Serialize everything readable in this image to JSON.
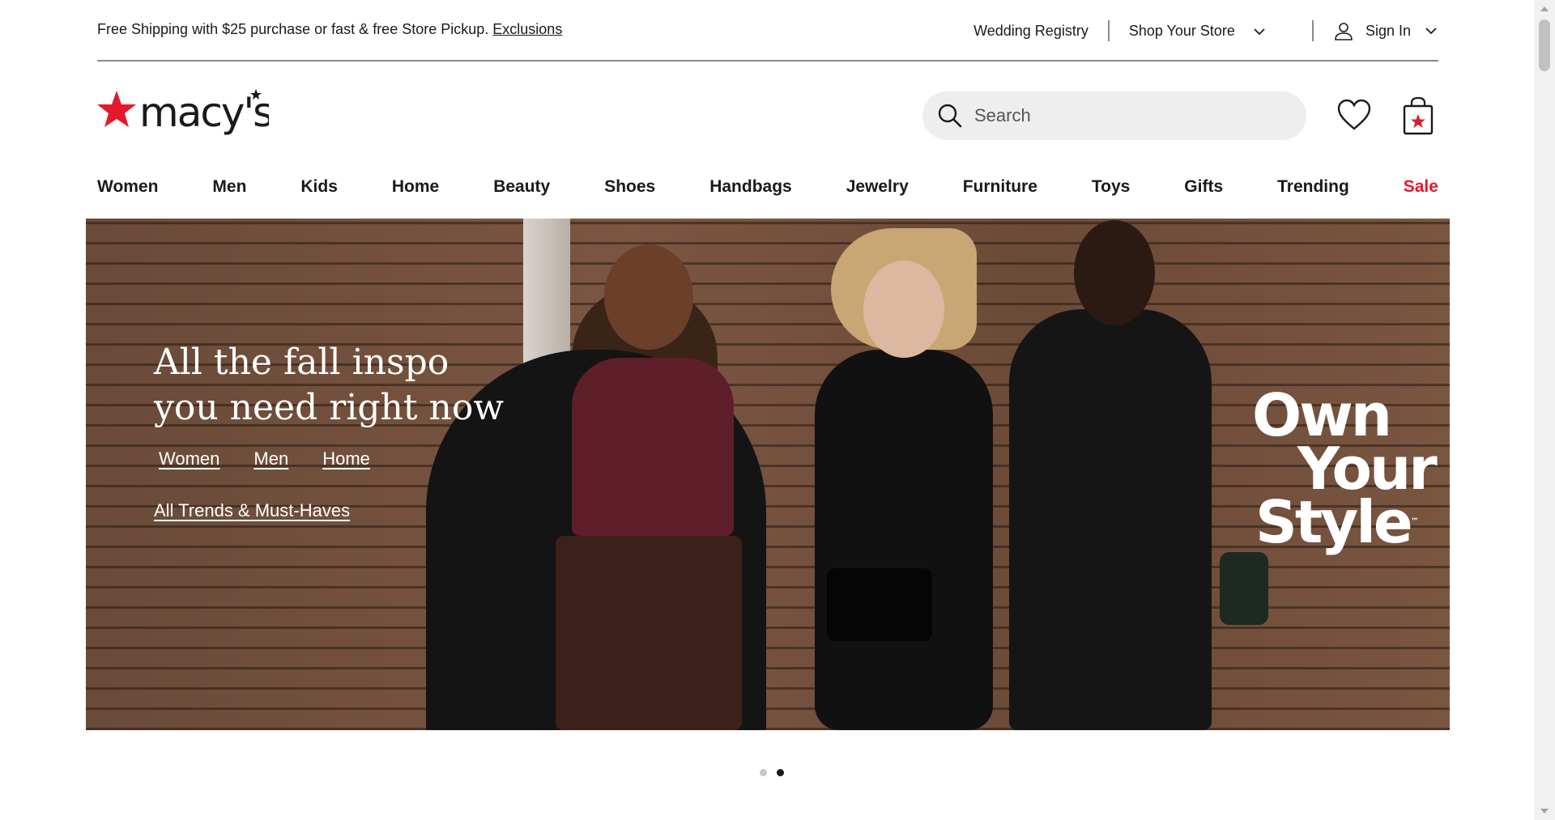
{
  "utility": {
    "promo_text": "Free Shipping with $25 purchase or fast & free Store Pickup.",
    "promo_link": "Exclusions",
    "wedding_registry": "Wedding Registry",
    "shop_your_store": "Shop Your Store",
    "sign_in": "Sign In"
  },
  "header": {
    "logo_text": "macy's",
    "search_placeholder": "Search"
  },
  "nav": {
    "items": [
      "Women",
      "Men",
      "Kids",
      "Home",
      "Beauty",
      "Shoes",
      "Handbags",
      "Jewelry",
      "Furniture",
      "Toys",
      "Gifts",
      "Trending",
      "Sale"
    ]
  },
  "hero": {
    "headline_line1": "All the fall inspo",
    "headline_line2": "you need right now",
    "links": [
      "Women",
      "Men",
      "Home"
    ],
    "cta": "All Trends & Must-Haves",
    "tagline_line1": "Own",
    "tagline_line2": "Your",
    "tagline_line3": "Style",
    "tagline_mark": "™"
  },
  "carousel": {
    "total_slides": 2,
    "active_slide": 2
  },
  "colors": {
    "brand_red": "#e21a2c",
    "text": "#1a1a1a",
    "search_bg": "#eeeeee"
  },
  "icons": {
    "user": "user-icon",
    "chevron": "chevron-down-icon",
    "search": "search-icon",
    "heart": "heart-icon",
    "bag": "shopping-bag-icon",
    "logo_star": "star-icon"
  }
}
